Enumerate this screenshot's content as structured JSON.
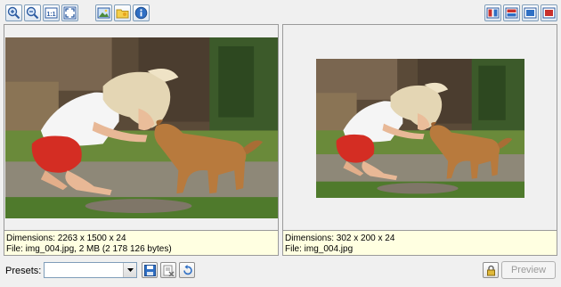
{
  "toolbar": {
    "left_icons": [
      "zoom-in-icon",
      "zoom-out-icon",
      "actual-size-icon",
      "fit-to-window-icon",
      "image-icon",
      "folder-icon",
      "info-icon"
    ],
    "right_icons": [
      "split-vertical-icon",
      "split-horizontal-icon",
      "single-view-icon",
      "original-view-icon"
    ],
    "accent": "#3a6fb5"
  },
  "original": {
    "dimensions": "Dimensions: 2263 x 1500 x 24",
    "file": "File: img_004.jpg, 2 MB (2 178 126 bytes)"
  },
  "preview": {
    "dimensions": "Dimensions: 302 x 200 x 24",
    "file": "File: img_004.jpg"
  },
  "bottom": {
    "presets_label": "Presets:",
    "presets_value": "",
    "preview_label": "Preview",
    "icons": [
      "save-preset-icon",
      "delete-preset-icon",
      "reset-icon",
      "lock-aspect-icon"
    ]
  }
}
